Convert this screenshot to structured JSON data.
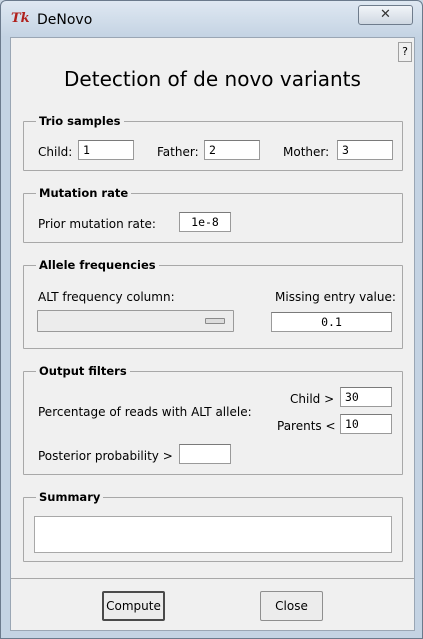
{
  "window": {
    "title": "DeNovo",
    "app_icon": "tk-logo",
    "close_label": "✕"
  },
  "help_label": "?",
  "heading": "Detection of de novo variants",
  "trio": {
    "title": "Trio samples",
    "child_label": "Child:",
    "child_value": "1",
    "father_label": "Father:",
    "father_value": "2",
    "mother_label": "Mother:",
    "mother_value": "3"
  },
  "mutation": {
    "title": "Mutation rate",
    "prior_label": "Prior mutation rate:",
    "prior_value": "1e-8"
  },
  "allele": {
    "title": "Allele frequencies",
    "alt_label": "ALT frequency column:",
    "alt_selected": "",
    "missing_label": "Missing entry value:",
    "missing_value": "0.1"
  },
  "filters": {
    "title": "Output filters",
    "percent_label": "Percentage of reads with ALT allele:",
    "child_label": "Child >",
    "child_value": "30",
    "parents_label": "Parents <",
    "parents_value": "10",
    "posterior_label": "Posterior probability >",
    "posterior_value": ""
  },
  "summary": {
    "title": "Summary",
    "text": ""
  },
  "buttons": {
    "compute": "Compute",
    "close": "Close"
  }
}
